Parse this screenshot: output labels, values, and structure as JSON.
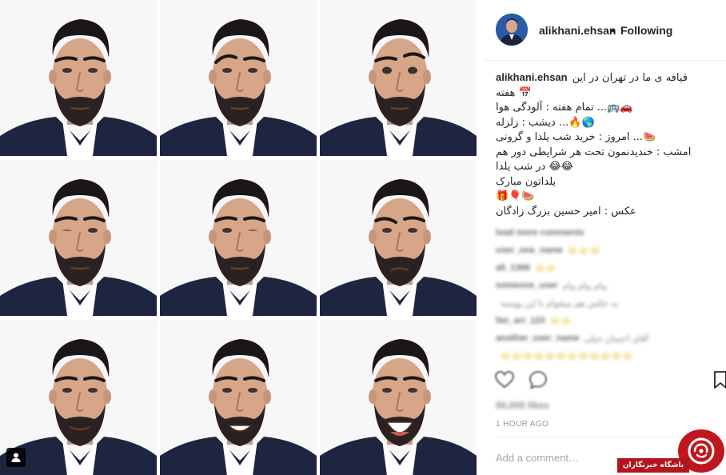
{
  "post": {
    "photo_alt": "9-portrait collage of facial expressions",
    "tiles": [
      {
        "expression": "neutral"
      },
      {
        "expression": "raised-brow"
      },
      {
        "expression": "wide-eyed"
      },
      {
        "expression": "wink-left"
      },
      {
        "expression": "wink-right"
      },
      {
        "expression": "sad"
      },
      {
        "expression": "slight-smile"
      },
      {
        "expression": "grin"
      },
      {
        "expression": "laugh"
      }
    ]
  },
  "header": {
    "username": "alikhani.ehsan",
    "separator": "•",
    "follow_status": "Following"
  },
  "caption": {
    "username": "alikhani.ehsan",
    "lines": [
      "قیافه ی ما در تهران در این",
      "📅 هفته",
      "🚗🚌... تمام هفته : آلودگی هوا",
      "🌎🔥... دیشب : زلزله",
      "🍉... امروز : خرید شب یلدا و گرونی",
      "امشب : خندیدنمون تحت هر شرایطی دور هم",
      "😂😂 در شب یلدا",
      "یلداتون مبارک",
      "🎁🎈🍉",
      "عکس : امیر حسین بزرگ زادگان"
    ]
  },
  "comments_blurred": [
    {
      "user": "load more comments",
      "text": ""
    },
    {
      "user": "user_one_name",
      "text": "😂😂😂"
    },
    {
      "user": "ali_1366",
      "text": "😂😂"
    },
    {
      "user": "someone_user",
      "text": "پیام پیام پیام"
    },
    {
      "user": "",
      "text": "یه عکس هم میخوام با این پوسته"
    },
    {
      "user": "fan_arr_123",
      "text": "😂😂"
    },
    {
      "user": "another_user_name",
      "text": "آقای احسان خیلی"
    },
    {
      "user": "",
      "text": "😂😂😂😂😂😂😂😂😂😂😂😂"
    }
  ],
  "actions": {
    "like_icon": "heart-icon",
    "comment_icon": "comment-icon",
    "save_icon": "bookmark-icon"
  },
  "likes_text": "00,000 likes",
  "timestamp": "1 HOUR AGO",
  "comment_placeholder": "Add a comment…",
  "watermark": {
    "label": "باشگاه خبرنگاران",
    "color": "#c0161e"
  }
}
